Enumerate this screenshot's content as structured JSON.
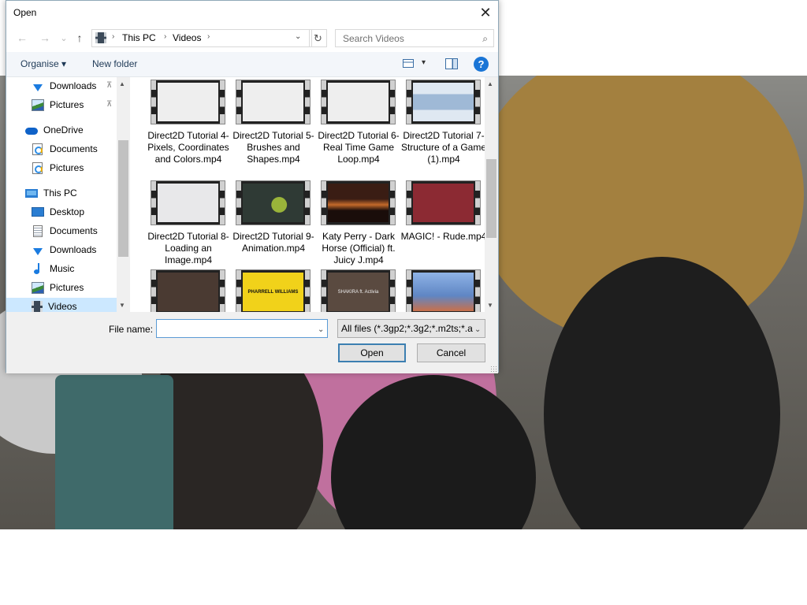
{
  "dialog": {
    "title": "Open",
    "close_glyph": "✕"
  },
  "nav_buttons": {
    "back_glyph": "←",
    "forward_glyph": "→",
    "recent_glyph": "⌄",
    "up_glyph": "↑"
  },
  "address": {
    "crumbs": [
      "This PC",
      "Videos"
    ],
    "separator": "›",
    "dropdown_glyph": "⌄",
    "refresh_glyph": "↻"
  },
  "search": {
    "placeholder": "Search Videos",
    "icon": "search-icon"
  },
  "toolbar": {
    "organise_label": "Organise ▾",
    "new_folder_label": "New folder",
    "view_dropdown_glyph": "▾",
    "help_label": "?"
  },
  "nav_pane": {
    "items": [
      {
        "label": "Downloads",
        "icon": "download-icon",
        "pinned": true
      },
      {
        "label": "Pictures",
        "icon": "pictures-icon",
        "pinned": true
      },
      {
        "label": "OneDrive",
        "icon": "onedrive-icon"
      },
      {
        "label": "Documents",
        "icon": "documents-icon"
      },
      {
        "label": "Pictures",
        "icon": "pictures-icon"
      },
      {
        "label": "This PC",
        "icon": "computer-icon"
      },
      {
        "label": "Desktop",
        "icon": "desktop-icon"
      },
      {
        "label": "Documents",
        "icon": "documents-icon"
      },
      {
        "label": "Downloads",
        "icon": "download-icon"
      },
      {
        "label": "Music",
        "icon": "music-icon"
      },
      {
        "label": "Pictures",
        "icon": "pictures-icon"
      },
      {
        "label": "Videos",
        "icon": "videos-icon",
        "selected": true
      }
    ],
    "pin_glyph": "📌"
  },
  "files": [
    {
      "name": "Direct2D Tutorial 4- Pixels, Coordinates and Colors.mp4",
      "thumb_color": "#eeeeee"
    },
    {
      "name": "Direct2D Tutorial 5- Brushes and Shapes.mp4",
      "thumb_color": "#eeeeee"
    },
    {
      "name": "Direct2D Tutorial 6- Real Time Game Loop.mp4",
      "thumb_color": "#eeeeee"
    },
    {
      "name": "Direct2D Tutorial 7- Structure of a Game (1).mp4",
      "thumb_color": "#dfe8f2"
    },
    {
      "name": "Direct2D Tutorial 8- Loading an Image.mp4",
      "thumb_color": "#e8e8ea"
    },
    {
      "name": "Direct2D Tutorial 9- Animation.mp4",
      "thumb_color": "#2f3a35"
    },
    {
      "name": "Katy Perry - Dark Horse (Official) ft. Juicy J.mp4",
      "thumb_color": "#3a1d14"
    },
    {
      "name": "MAGIC! - Rude.mp4",
      "thumb_color": "#8c2a33"
    },
    {
      "name": "",
      "thumb_color": "#4a3a32"
    },
    {
      "name": "",
      "thumb_color": "#f1d21a",
      "thumb_text": "PHARRELL WILLIAMS"
    },
    {
      "name": "",
      "thumb_color": "#5a4a40",
      "thumb_text": "SHAKIRA ft. Activia"
    },
    {
      "name": "",
      "thumb_color": "#5f86c4"
    }
  ],
  "bottom": {
    "filename_label": "File name:",
    "filename_value": "",
    "filetype_value": "All files (*.3gp2;*.3g2;*.m2ts;*.a",
    "open_label": "Open",
    "cancel_label": "Cancel",
    "dropdown_glyph": "⌄"
  },
  "scroll_arrows": {
    "up": "▲",
    "down": "▼"
  }
}
